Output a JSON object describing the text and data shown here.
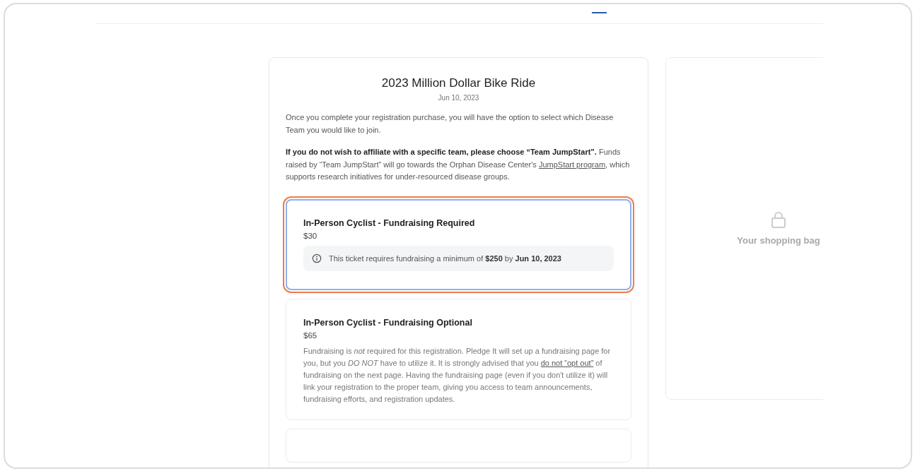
{
  "event": {
    "title": "2023 Million Dollar Bike Ride",
    "date": "Jun 10, 2023",
    "intro": "Once you complete your registration purchase, you will have the option to select which Disease Team you would like to join.",
    "notice": [
      {
        "kind": "text",
        "text": "**If you do not wish to affiliate with a specific team, please choose “Team JumpStart”.** Funds raised by “Team JumpStart” will go towards the Orphan Disease Center's "
      },
      {
        "kind": "link",
        "text": "JumpStart program"
      },
      {
        "kind": "text",
        "text": ", which supports research initiatives for under-resourced disease groups."
      }
    ]
  },
  "tickets": [
    {
      "name": "In-Person Cyclist - Fundraising Required",
      "price": "$30",
      "selected": true,
      "note": "This ticket requires fundraising a minimum of **$250** by **Jun 10, 2023**"
    },
    {
      "name": "In-Person Cyclist - Fundraising Optional",
      "price": "$65",
      "selected": false,
      "description": [
        {
          "kind": "text",
          "text": "Fundraising is *not* required for this registration. Pledge It will set up a fundraising page for you, but you *DO NOT* have to utilize it. It is strongly advised that you "
        },
        {
          "kind": "link",
          "text": "do not “opt out”"
        },
        {
          "kind": "text",
          "text": " of fundraising on the next page. Having the fundraising page (even if you don't utilize it) will link your registration to the proper team, giving you access to team announcements, fundraising efforts, and registration updates."
        }
      ]
    },
    {
      "selected": false
    }
  ],
  "cart": {
    "empty_text": "Your shopping bag"
  }
}
